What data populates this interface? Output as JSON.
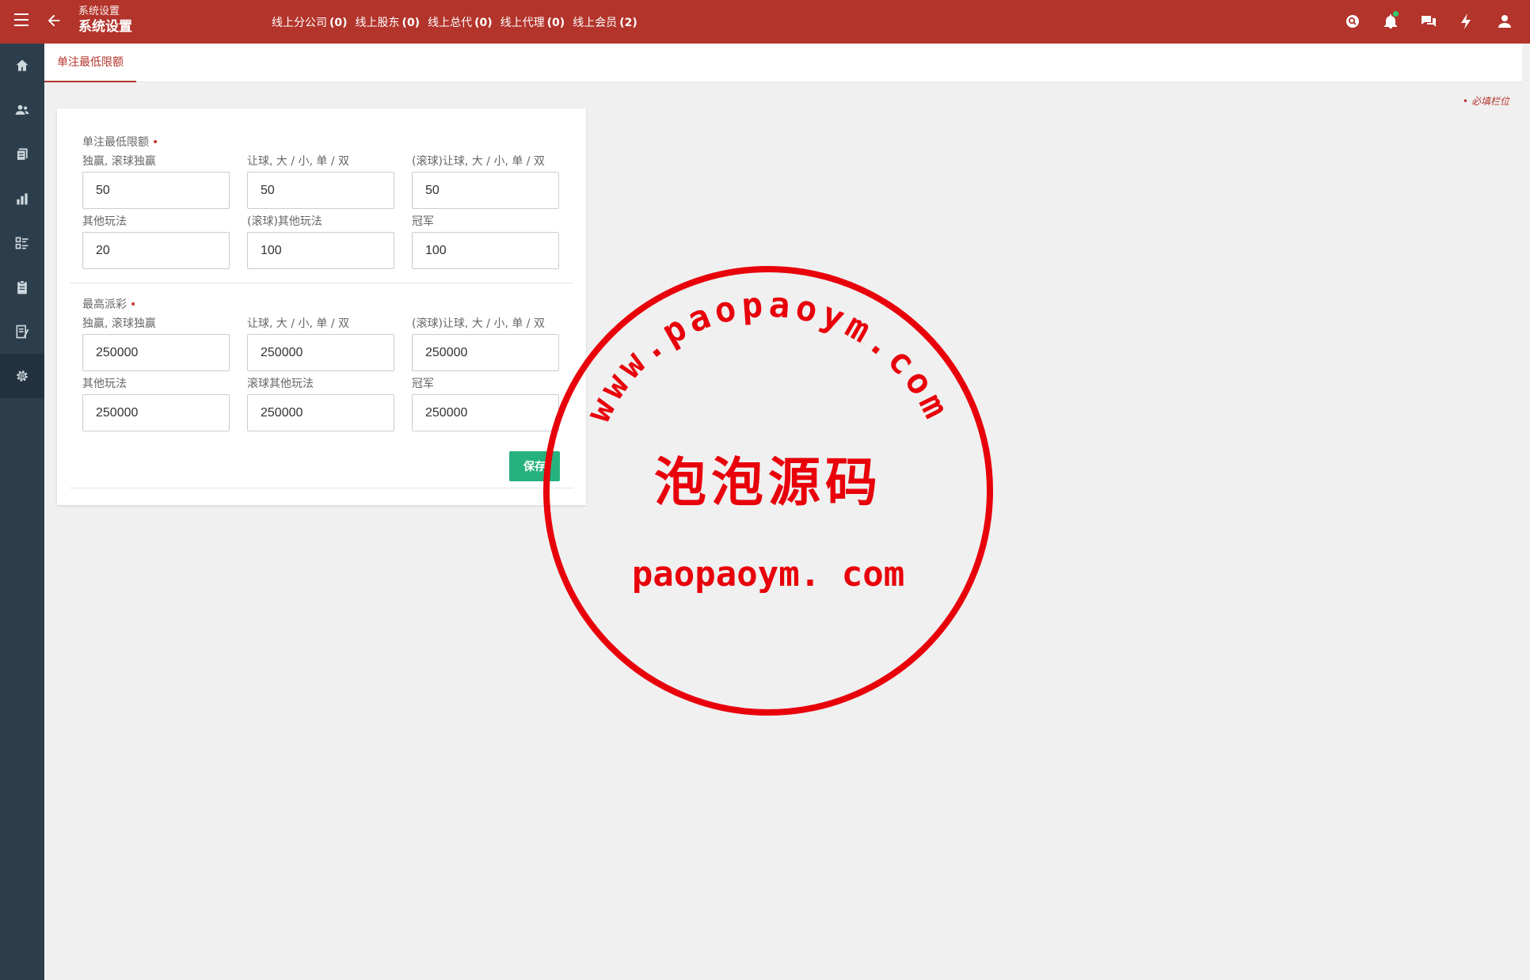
{
  "header": {
    "breadcrumb": "系统设置",
    "title": "系统设置",
    "counts": [
      {
        "label": "线上分公司",
        "count": "(0)"
      },
      {
        "label": "线上股东",
        "count": "(0)"
      },
      {
        "label": "线上总代",
        "count": "(0)"
      },
      {
        "label": "线上代理",
        "count": "(0)"
      },
      {
        "label": "线上会员",
        "count": "(2)"
      }
    ],
    "icons": [
      "search-icon",
      "bell-icon",
      "chat-icon",
      "lightning-icon",
      "user-icon"
    ]
  },
  "sidebar": {
    "items": [
      "home-icon",
      "users-icon",
      "documents-icon",
      "chart-icon",
      "list-icon",
      "clipboard-icon",
      "report-icon",
      "gear-icon"
    ],
    "active_index": 7
  },
  "tabs": [
    {
      "label": "单注最低限额",
      "active": true
    }
  ],
  "required_note": "必填栏位",
  "form": {
    "min_bet": {
      "label": "单注最低限额",
      "required_mark": "•",
      "fields": [
        {
          "label": "独赢, 滚球独赢",
          "value": "50"
        },
        {
          "label": "让球, 大 / 小, 单 / 双",
          "value": "50"
        },
        {
          "label": "(滚球)让球, 大 / 小, 单 / 双",
          "value": "50"
        },
        {
          "label": "其他玩法",
          "value": "20"
        },
        {
          "label": "(滚球)其他玩法",
          "value": "100"
        },
        {
          "label": "冠军",
          "value": "100"
        }
      ]
    },
    "max_payout": {
      "label": "最高派彩",
      "required_mark": "•",
      "fields": [
        {
          "label": "独赢, 滚球独赢",
          "value": "250000"
        },
        {
          "label": "让球, 大 / 小, 单 / 双",
          "value": "250000"
        },
        {
          "label": "(滚球)让球, 大 / 小, 单 / 双",
          "value": "250000"
        },
        {
          "label": "其他玩法",
          "value": "250000"
        },
        {
          "label": "滚球其他玩法",
          "value": "250000"
        },
        {
          "label": "冠军",
          "value": "250000"
        }
      ]
    },
    "save_label": "保存"
  },
  "watermark": {
    "arc_text": "www.paopaoym.com",
    "center_text": "泡泡源码",
    "bottom_text": "paopaoym. com",
    "color": "#e8000a"
  },
  "colors": {
    "header": "#b3342b",
    "sidebar": "#2c3e4c",
    "save": "#26b27f"
  }
}
